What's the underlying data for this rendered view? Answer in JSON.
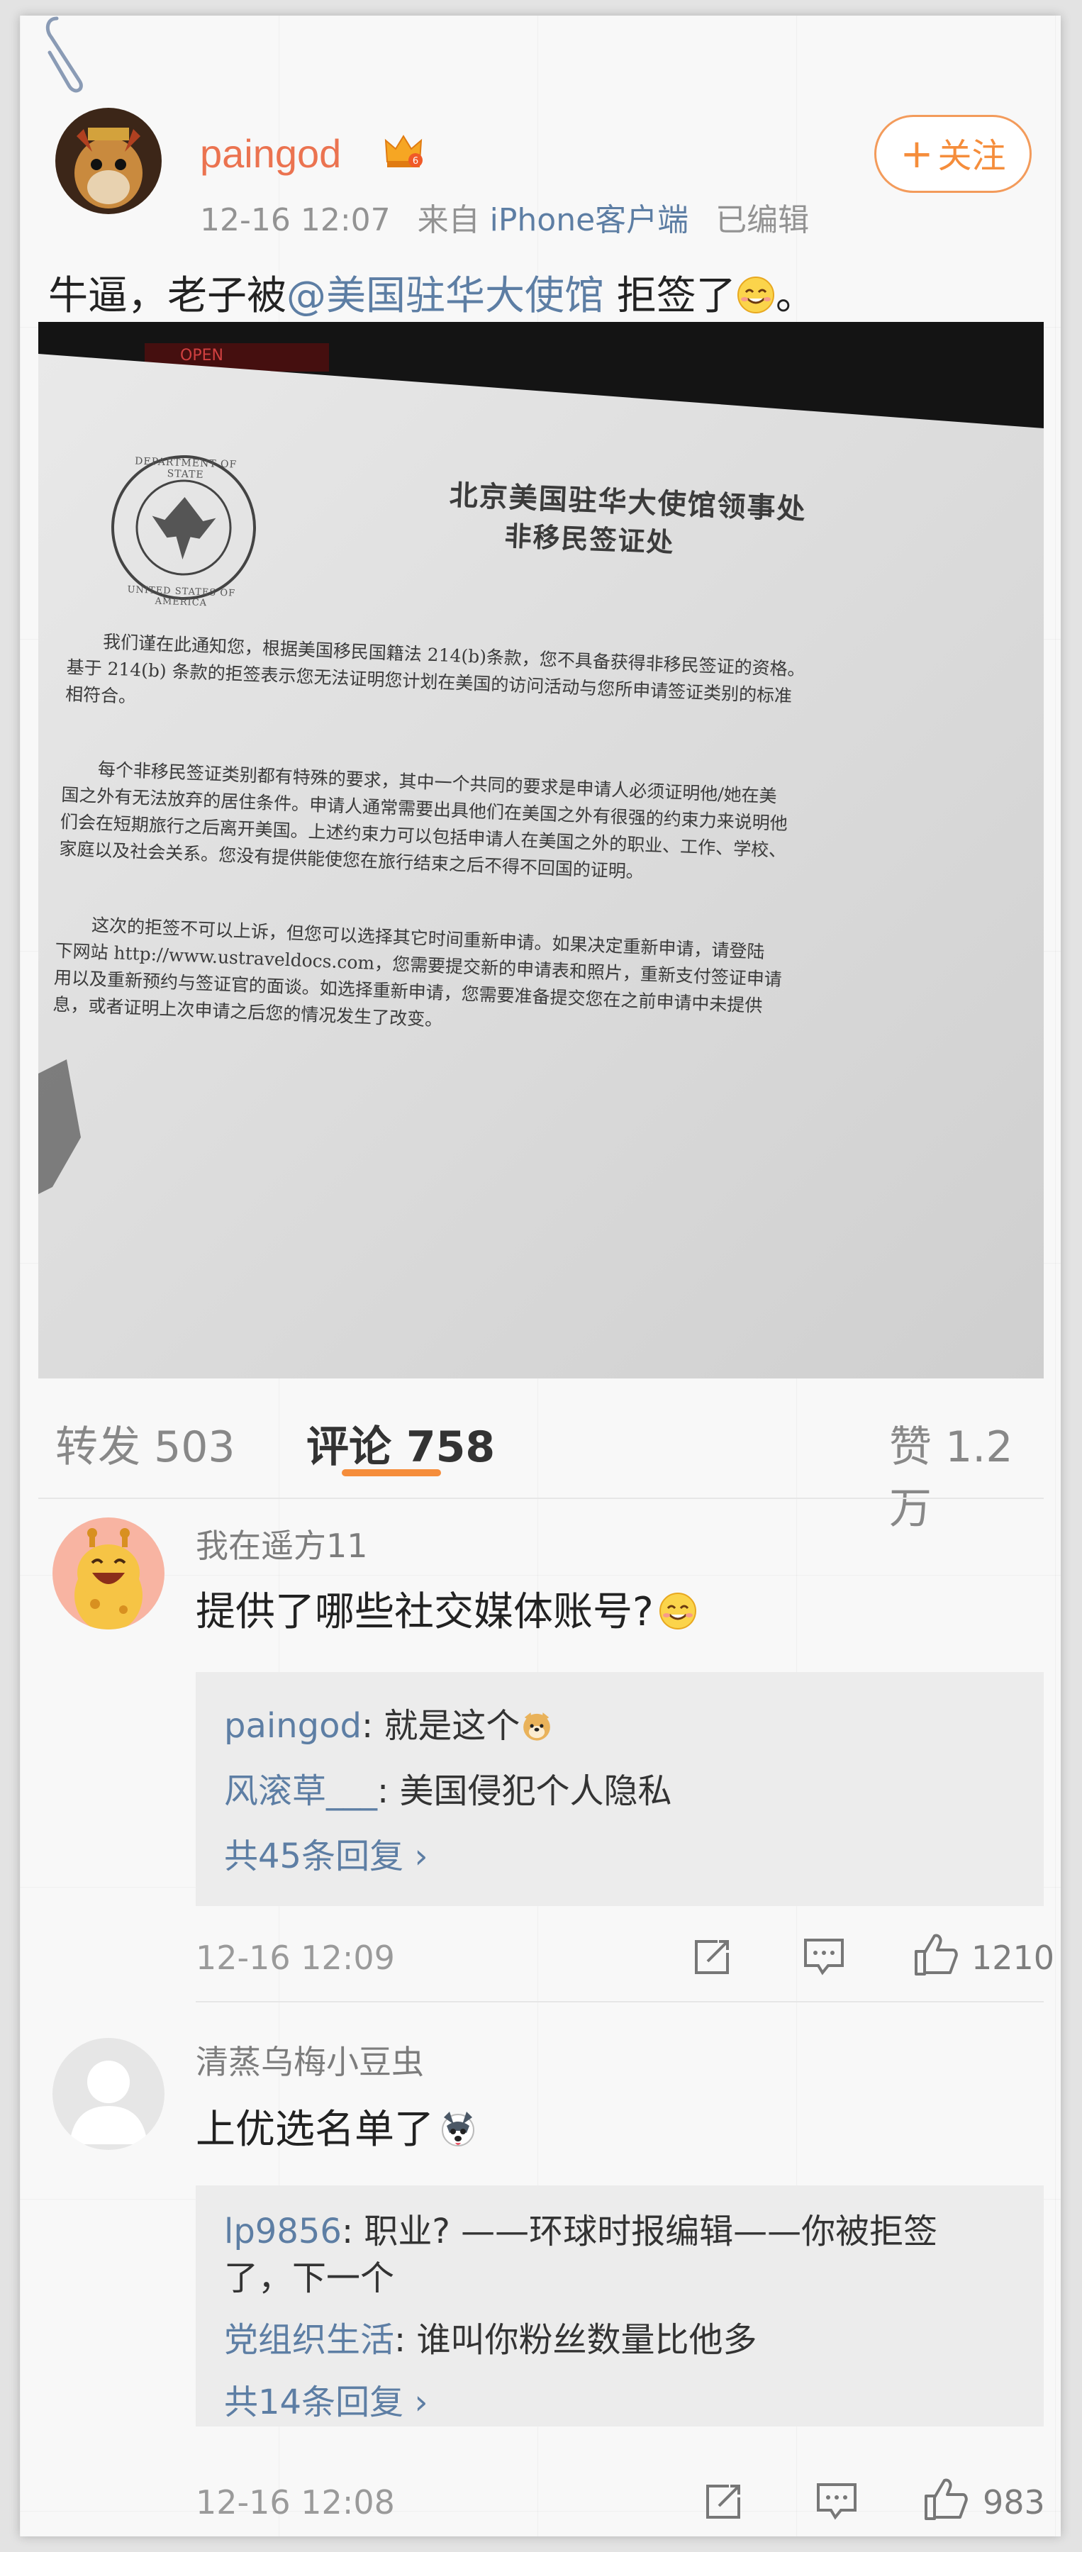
{
  "post": {
    "username": "paingod",
    "time": "12-16 12:07",
    "source_prefix": "来自",
    "source_client": "iPhone客户端",
    "edited": "已编辑",
    "follow_label": "关注",
    "follow_plus": "+",
    "text_before": "牛逼，老子被",
    "mention": "@美国驻华大使馆",
    "text_after": " 拒签了",
    "text_end": "。"
  },
  "letter": {
    "seal_top": "DEPARTMENT OF STATE",
    "seal_bottom": "UNITED STATES OF AMERICA",
    "title1": "北京美国驻华大使馆领事处",
    "title2": "非移民签证处",
    "p1": [
      "我们谨在此通知您，根据美国移民国籍法 214(b)条款，您不具备获得非移民签证的资格。",
      "基于 214(b) 条款的拒签表示您无法证明您计划在美国的访问活动与您所申请签证类别的标准",
      "相符合。"
    ],
    "p2": [
      "每个非移民签证类别都有特殊的要求，其中一个共同的要求是申请人必须证明他/她在美",
      "国之外有无法放弃的居住条件。申请人通常需要出具他们在美国之外有很强的约束力来说明他",
      "们会在短期旅行之后离开美国。上述约束力可以包括申请人在美国之外的职业、工作、学校、",
      "家庭以及社会关系。您没有提供能使您在旅行结束之后不得不回国的证明。"
    ],
    "p3": [
      "这次的拒签不可以上诉，但您可以选择其它时间重新申请。如果决定重新申请，请登陆",
      "下网站 http://www.ustraveldocs.com，您需要提交新的申请表和照片，重新支付签证申请",
      "用以及重新预约与签证官的面谈。如选择重新申请，您需要准备提交您在之前申请中未提供",
      "息，或者证明上次申请之后您的情况发生了改变。"
    ]
  },
  "tabs": {
    "repost_label": "转发",
    "repost_count": "503",
    "comment_label": "评论",
    "comment_count": "758",
    "like_label": "赞",
    "like_count": "1.2万"
  },
  "comments": [
    {
      "name": "我在遥方11",
      "text": "提供了哪些社交媒体账号?",
      "replies": [
        {
          "name": "paingod",
          "text": ": 就是这个"
        },
        {
          "name": "风滚草___",
          "text": ": 美国侵犯个人隐私"
        }
      ],
      "more": "共45条回复",
      "time": "12-16 12:09",
      "likes": "1210"
    },
    {
      "name": "清蒸乌梅小豆虫",
      "text": "上优选名单了",
      "replies": [
        {
          "name": "lp9856",
          "text": ": 职业? ——环球时报编辑——你被拒签",
          "text2": "了，下一个"
        },
        {
          "name": "党组织生活",
          "text": ": 谁叫你粉丝数量比他多"
        }
      ],
      "more": "共14条回复",
      "time": "12-16 12:08",
      "likes": "983"
    }
  ],
  "chevron": "›",
  "colors": {
    "orange": "#f58d3b",
    "username": "#eb7350",
    "link": "#5d7ea4"
  },
  "icons": [
    "paperclip-icon",
    "crown-badge-icon",
    "smile-emoji-icon",
    "dog-emoji-icon",
    "doge-emoji-icon",
    "repost-icon",
    "comment-icon",
    "like-icon"
  ]
}
